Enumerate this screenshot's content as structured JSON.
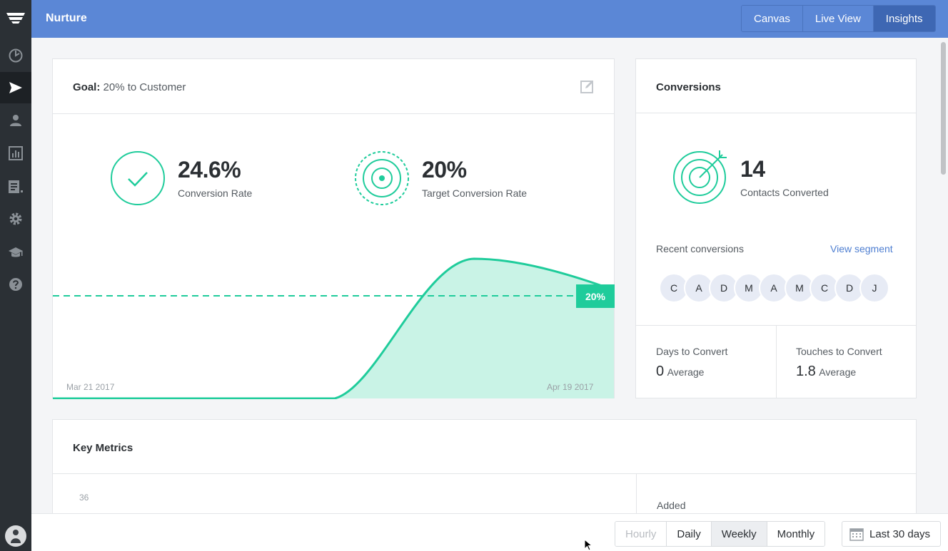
{
  "header": {
    "title": "Nurture",
    "tabs": [
      {
        "label": "Canvas",
        "active": false
      },
      {
        "label": "Live View",
        "active": false
      },
      {
        "label": "Insights",
        "active": true
      }
    ]
  },
  "sidebar": {
    "items": [
      {
        "icon": "logo-icon"
      },
      {
        "icon": "dashboard-icon"
      },
      {
        "icon": "send-icon",
        "active": true
      },
      {
        "icon": "contacts-icon"
      },
      {
        "icon": "reports-icon"
      },
      {
        "icon": "lists-icon"
      },
      {
        "icon": "gear-icon"
      },
      {
        "icon": "graduation-cap-icon"
      },
      {
        "icon": "help-icon"
      }
    ]
  },
  "goal": {
    "label": "Goal:",
    "value": "20% to Customer",
    "conversion_rate": "24.6%",
    "conversion_rate_label": "Conversion Rate",
    "target_rate": "20%",
    "target_rate_label": "Target Conversion Rate",
    "chart": {
      "start_date": "Mar 21 2017",
      "end_date": "Apr 19 2017",
      "target_badge": "20%",
      "target_value": 20
    }
  },
  "conversions": {
    "title": "Conversions",
    "count": "14",
    "count_label": "Contacts Converted",
    "recent_label": "Recent conversions",
    "view_segment": "View segment",
    "avatars": [
      "C",
      "A",
      "D",
      "M",
      "A",
      "M",
      "C",
      "D",
      "J"
    ],
    "days": {
      "label": "Days to Convert",
      "value": "0",
      "unit": "Average"
    },
    "touches": {
      "label": "Touches to Convert",
      "value": "1.8",
      "unit": "Average"
    }
  },
  "key_metrics": {
    "title": "Key Metrics",
    "y_tick": "36",
    "added_label": "Added"
  },
  "bottombar": {
    "granularity": [
      {
        "label": "Hourly",
        "state": "disabled"
      },
      {
        "label": "Daily",
        "state": "normal"
      },
      {
        "label": "Weekly",
        "state": "active"
      },
      {
        "label": "Monthly",
        "state": "normal"
      }
    ],
    "range": "Last 30 days"
  },
  "colors": {
    "accent": "#1fcc9b",
    "header": "#5b87d6",
    "sidebar": "#2b3035",
    "link": "#4f7fd1"
  }
}
